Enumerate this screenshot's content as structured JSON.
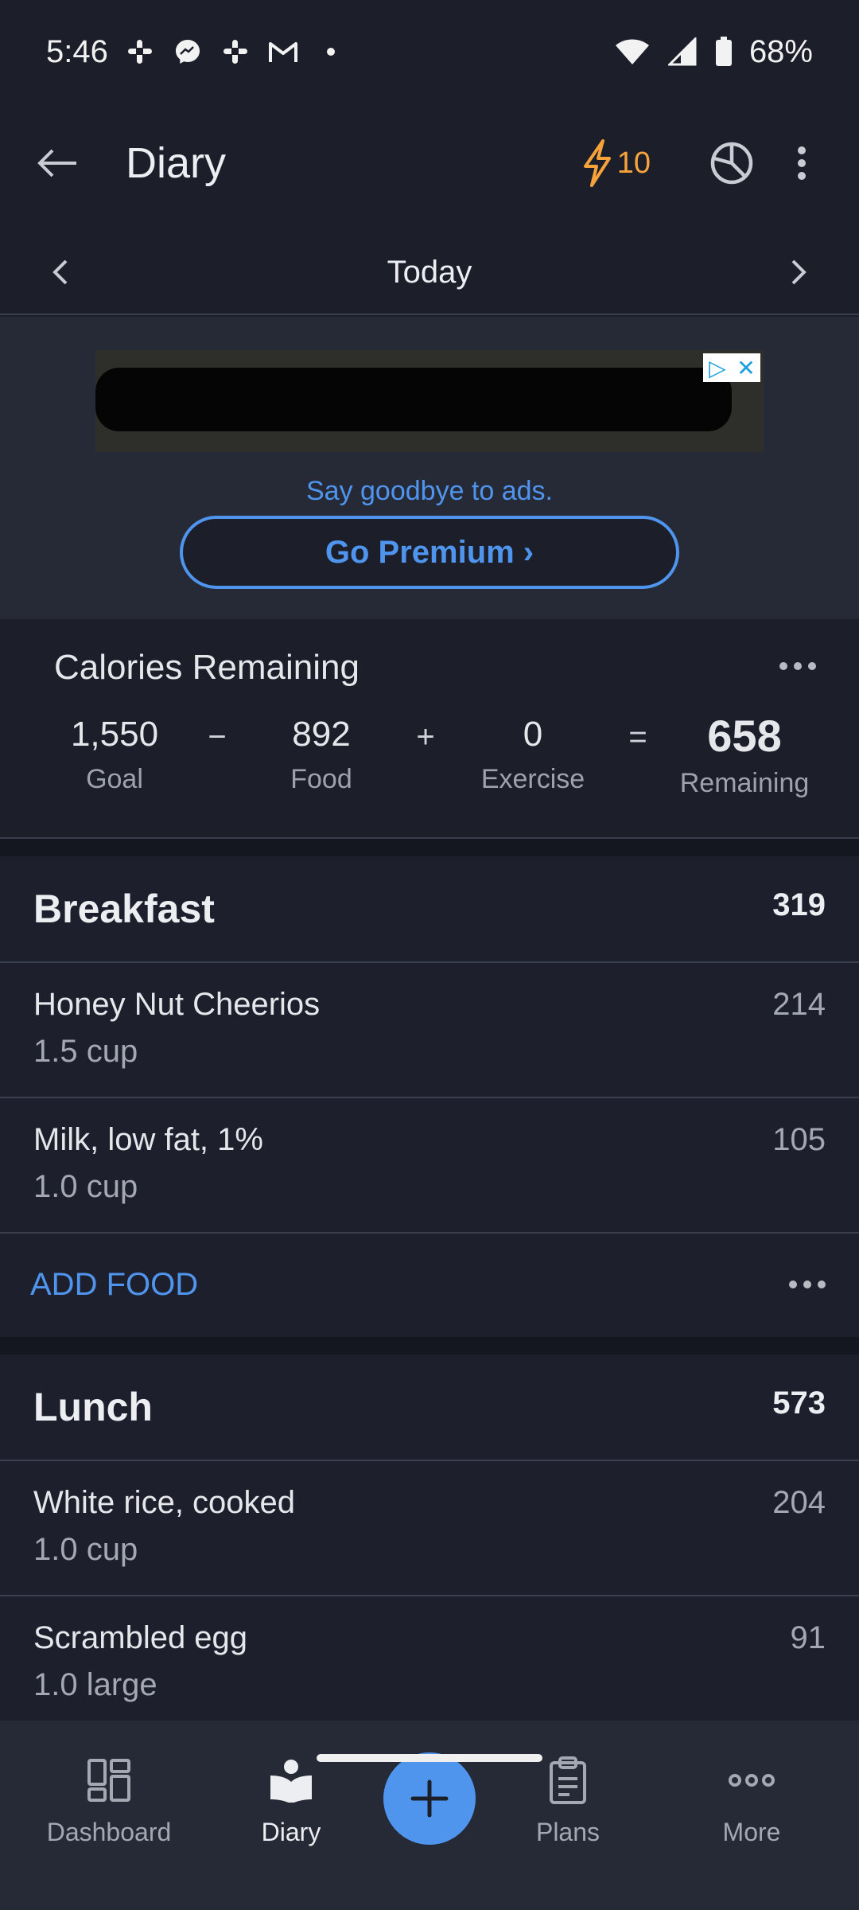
{
  "status": {
    "time": "5:46",
    "battery": "68%",
    "notification_icons": [
      "slack-icon",
      "messenger-icon",
      "slack-icon",
      "gmail-icon",
      "dot-icon"
    ]
  },
  "header": {
    "title": "Diary",
    "streak_count": "10"
  },
  "date_nav": {
    "label": "Today"
  },
  "ad": {
    "tagline": "Say goodbye to ads.",
    "premium_label": "Go Premium ›"
  },
  "calories": {
    "title": "Calories Remaining",
    "goal_value": "1,550",
    "goal_label": "Goal",
    "food_value": "892",
    "food_label": "Food",
    "exercise_value": "0",
    "exercise_label": "Exercise",
    "remaining_value": "658",
    "remaining_label": "Remaining",
    "op_minus": "−",
    "op_plus": "+",
    "op_equals": "="
  },
  "meals": [
    {
      "name": "Breakfast",
      "total": "319",
      "foods": [
        {
          "name": "Honey Nut Cheerios",
          "qty": "1.5 cup",
          "cal": "214"
        },
        {
          "name": "Milk, low fat, 1%",
          "qty": "1.0 cup",
          "cal": "105"
        }
      ],
      "add_label": "ADD FOOD"
    },
    {
      "name": "Lunch",
      "total": "573",
      "foods": [
        {
          "name": "White rice, cooked",
          "qty": "1.0 cup",
          "cal": "204"
        },
        {
          "name": "Scrambled egg",
          "qty": "1.0 large",
          "cal": "91"
        }
      ]
    }
  ],
  "bottom_nav": {
    "dashboard": "Dashboard",
    "diary": "Diary",
    "plans": "Plans",
    "more": "More"
  },
  "colors": {
    "background": "#1c1f2a",
    "accent": "#4f95ee",
    "streak": "#f7a23b"
  }
}
